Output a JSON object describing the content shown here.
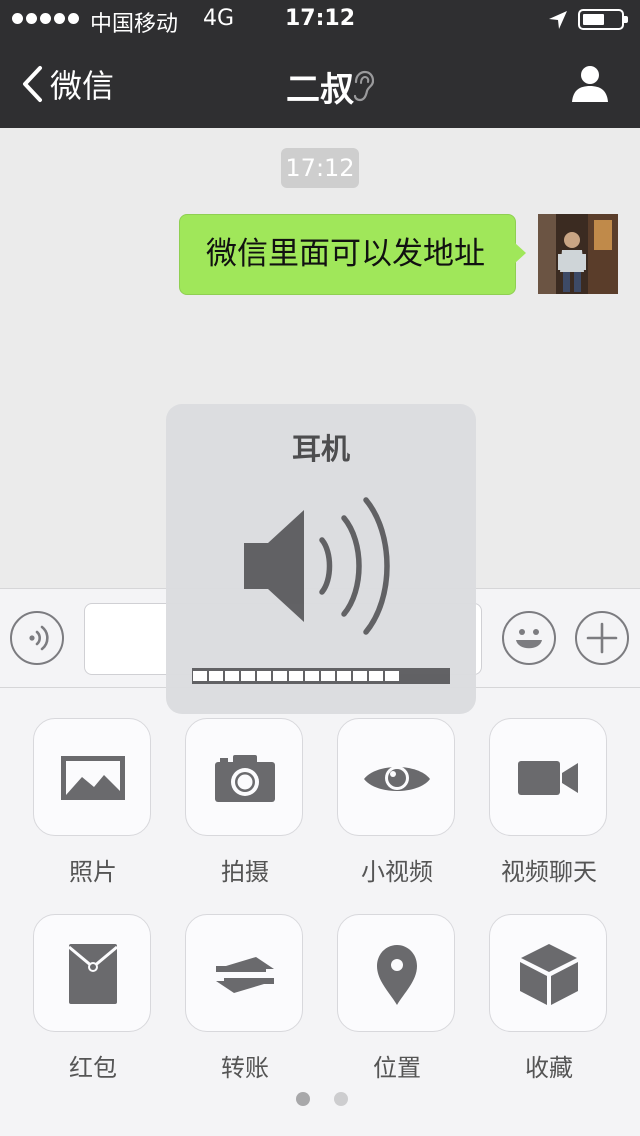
{
  "status_bar": {
    "carrier": "中国移动",
    "network": "4G",
    "time": "17:12",
    "signal_dots": 5,
    "battery_level": 0.55
  },
  "nav": {
    "back_label": "微信",
    "title": "二叔",
    "back_icon": "chevron-left-icon",
    "mode_icon": "earpiece-icon",
    "profile_icon": "person-icon"
  },
  "chat": {
    "timestamp": "17:12",
    "messages": [
      {
        "side": "right",
        "text": "微信里面可以发地址"
      }
    ]
  },
  "input_bar": {
    "voice_icon": "voice-icon",
    "emoji_icon": "emoji-icon",
    "plus_icon": "plus-icon",
    "value": ""
  },
  "panel": {
    "items": [
      {
        "label": "照片",
        "icon": "photo-icon"
      },
      {
        "label": "拍摄",
        "icon": "camera-icon"
      },
      {
        "label": "小视频",
        "icon": "eye-icon"
      },
      {
        "label": "视频聊天",
        "icon": "video-camera-icon"
      },
      {
        "label": "红包",
        "icon": "red-packet-icon"
      },
      {
        "label": "转账",
        "icon": "transfer-icon"
      },
      {
        "label": "位置",
        "icon": "location-pin-icon"
      },
      {
        "label": "收藏",
        "icon": "cube-icon"
      }
    ],
    "page_count": 2,
    "current_page": 1
  },
  "volume_hud": {
    "title": "耳机",
    "icon": "speaker-icon",
    "level": 0.8125
  },
  "colors": {
    "nav_bg": "#2f2f31",
    "bubble_green": "#a0e75a",
    "chat_bg": "#ebebeb",
    "panel_bg": "#f4f4f6"
  }
}
